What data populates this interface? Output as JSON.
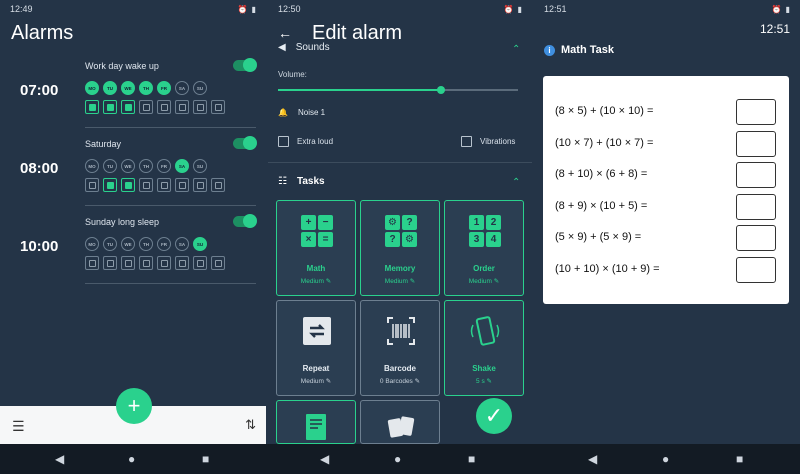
{
  "colors": {
    "accent": "#2ad18d",
    "background": "#243447",
    "card": "#ffffff"
  },
  "panel1": {
    "status_time": "12:49",
    "title": "Alarms",
    "alarms": [
      {
        "time": "07:00",
        "name": "Work day wake up",
        "days_on": [
          true,
          true,
          true,
          true,
          true,
          false,
          false
        ],
        "tasks_on": [
          true,
          true,
          true,
          false,
          false,
          false,
          false,
          false
        ]
      },
      {
        "time": "08:00",
        "name": "Saturday",
        "days_on": [
          false,
          false,
          false,
          false,
          false,
          true,
          false
        ],
        "tasks_on": [
          false,
          true,
          true,
          false,
          false,
          false,
          false,
          false
        ]
      },
      {
        "time": "10:00",
        "name": "Sunday long sleep",
        "days_on": [
          false,
          false,
          false,
          false,
          false,
          false,
          true
        ],
        "tasks_on": [
          false,
          false,
          false,
          false,
          false,
          false,
          false,
          false
        ]
      }
    ],
    "day_labels": [
      "MO",
      "TU",
      "WE",
      "TH",
      "FR",
      "SA",
      "SU"
    ],
    "fab_label": "+",
    "menu_icon": "hamburger-menu-icon",
    "sort_icon": "sort-icon"
  },
  "panel2": {
    "status_time": "12:50",
    "title": "Edit alarm",
    "sounds_label": "Sounds",
    "volume_label": "Volume:",
    "volume_level": 0.68,
    "noise_label": "Noise 1",
    "extra_loud_label": "Extra loud",
    "vibrations_label": "Vibrations",
    "tasks_label": "Tasks",
    "tiles": [
      {
        "name": "Math",
        "sub": "Medium",
        "active": true
      },
      {
        "name": "Memory",
        "sub": "Medium",
        "active": true
      },
      {
        "name": "Order",
        "sub": "Medium",
        "active": true
      },
      {
        "name": "Repeat",
        "sub": "Medium",
        "active": false
      },
      {
        "name": "Barcode",
        "sub": "0 Barcodes",
        "active": false
      },
      {
        "name": "Shake",
        "sub": "5 s",
        "active": true
      }
    ],
    "memory_glyph": "?",
    "order_digits": [
      "1",
      "2",
      "3",
      "4"
    ],
    "math_ops": [
      "+",
      "−",
      "×",
      "="
    ]
  },
  "panel3": {
    "status_time": "12:51",
    "clock": "12:51",
    "title": "Math Task",
    "equations": [
      "(8 × 5) + (10 × 10) =",
      "(10 × 7) + (10 × 7) =",
      "(8 + 10) × (6 + 8) =",
      "(8 + 9) × (10 + 5) =",
      "(5 × 9) + (5 × 9) =",
      "(10 + 10) × (10 + 9) ="
    ]
  }
}
